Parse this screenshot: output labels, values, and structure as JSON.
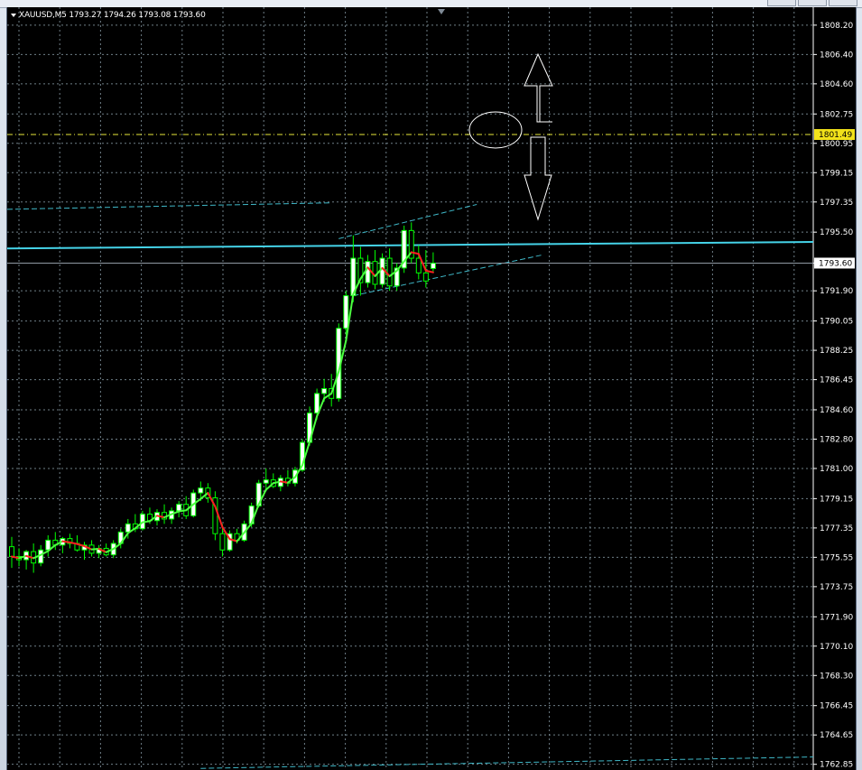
{
  "window": {
    "symbol_menu_icon": "triangle-down-icon"
  },
  "chart_data": {
    "type": "candlestick",
    "symbol": "XAUUSD,M5",
    "header_text": "XAUUSD,M5  1793.27 1794.26 1793.08 1793.60",
    "ohlc_header": {
      "open": 1793.27,
      "high": 1794.26,
      "low": 1793.08,
      "close": 1793.6
    },
    "ylim": [
      1762.5,
      1809.3
    ],
    "yticks": [
      "1808.20",
      "1806.40",
      "1804.60",
      "1802.75",
      "1800.95",
      "1799.15",
      "1797.35",
      "1795.50",
      "1793.60",
      "1791.90",
      "1790.05",
      "1788.25",
      "1786.45",
      "1784.60",
      "1782.80",
      "1781.00",
      "1779.15",
      "1777.35",
      "1775.55",
      "1773.75",
      "1771.90",
      "1770.10",
      "1768.30",
      "1766.45",
      "1764.65",
      "1762.85"
    ],
    "grid": true,
    "bid_price": {
      "value": 1793.6,
      "label": "1793.60"
    },
    "alert_line": {
      "value": 1801.49,
      "label": "1801.49"
    },
    "candles": [
      [
        1776.2,
        1776.8,
        1774.9,
        1775.6
      ],
      [
        1775.6,
        1776.1,
        1775.0,
        1775.4
      ],
      [
        1775.4,
        1776.0,
        1774.8,
        1775.9
      ],
      [
        1775.9,
        1776.4,
        1774.6,
        1775.2
      ],
      [
        1775.2,
        1776.3,
        1775.0,
        1776.0
      ],
      [
        1776.0,
        1776.9,
        1775.6,
        1776.6
      ],
      [
        1776.6,
        1777.1,
        1776.0,
        1776.3
      ],
      [
        1776.3,
        1776.8,
        1775.8,
        1776.7
      ],
      [
        1776.7,
        1777.0,
        1776.1,
        1776.4
      ],
      [
        1776.4,
        1776.9,
        1775.9,
        1776.0
      ],
      [
        1776.0,
        1776.5,
        1775.4,
        1776.3
      ],
      [
        1776.3,
        1776.6,
        1775.6,
        1775.8
      ],
      [
        1775.8,
        1776.3,
        1775.5,
        1776.1
      ],
      [
        1776.1,
        1776.4,
        1775.6,
        1775.7
      ],
      [
        1775.7,
        1776.6,
        1775.5,
        1776.4
      ],
      [
        1776.4,
        1777.3,
        1776.1,
        1777.1
      ],
      [
        1777.1,
        1777.9,
        1776.7,
        1777.6
      ],
      [
        1777.6,
        1778.2,
        1777.1,
        1777.3
      ],
      [
        1777.3,
        1778.4,
        1777.2,
        1778.2
      ],
      [
        1778.2,
        1778.6,
        1777.6,
        1777.8
      ],
      [
        1777.8,
        1778.5,
        1777.5,
        1778.3
      ],
      [
        1778.3,
        1778.8,
        1777.6,
        1777.9
      ],
      [
        1777.9,
        1778.6,
        1777.6,
        1778.4
      ],
      [
        1778.4,
        1779.0,
        1778.0,
        1778.8
      ],
      [
        1778.8,
        1779.3,
        1777.9,
        1778.1
      ],
      [
        1778.1,
        1779.7,
        1778.0,
        1779.5
      ],
      [
        1779.5,
        1780.2,
        1779.0,
        1779.8
      ],
      [
        1779.8,
        1780.1,
        1778.9,
        1779.2
      ],
      [
        1779.2,
        1779.6,
        1776.6,
        1777.0
      ],
      [
        1777.0,
        1777.6,
        1775.6,
        1776.0
      ],
      [
        1776.0,
        1777.2,
        1775.9,
        1777.0
      ],
      [
        1777.0,
        1777.3,
        1776.4,
        1776.6
      ],
      [
        1776.6,
        1777.8,
        1776.5,
        1777.6
      ],
      [
        1777.6,
        1778.9,
        1777.4,
        1778.7
      ],
      [
        1778.7,
        1780.3,
        1778.6,
        1780.1
      ],
      [
        1780.1,
        1781.0,
        1779.6,
        1780.3
      ],
      [
        1780.3,
        1780.7,
        1779.8,
        1779.9
      ],
      [
        1779.9,
        1780.6,
        1779.6,
        1780.4
      ],
      [
        1780.4,
        1780.9,
        1779.9,
        1780.1
      ],
      [
        1780.1,
        1781.1,
        1779.9,
        1780.9
      ],
      [
        1780.9,
        1782.8,
        1780.8,
        1782.6
      ],
      [
        1782.6,
        1784.8,
        1782.4,
        1784.4
      ],
      [
        1784.4,
        1785.9,
        1784.0,
        1785.6
      ],
      [
        1785.6,
        1786.5,
        1785.1,
        1785.9
      ],
      [
        1785.9,
        1786.8,
        1784.8,
        1785.3
      ],
      [
        1785.3,
        1789.9,
        1785.1,
        1789.6
      ],
      [
        1789.6,
        1791.9,
        1789.2,
        1791.6
      ],
      [
        1791.6,
        1795.3,
        1791.2,
        1793.9
      ],
      [
        1793.9,
        1794.6,
        1791.6,
        1792.4
      ],
      [
        1792.4,
        1794.1,
        1792.1,
        1793.7
      ],
      [
        1793.7,
        1794.4,
        1792.0,
        1792.3
      ],
      [
        1792.3,
        1794.2,
        1792.1,
        1793.9
      ],
      [
        1793.9,
        1794.5,
        1791.9,
        1792.2
      ],
      [
        1792.2,
        1793.6,
        1791.9,
        1793.3
      ],
      [
        1793.3,
        1795.9,
        1793.0,
        1795.6
      ],
      [
        1795.6,
        1796.1,
        1793.6,
        1793.9
      ],
      [
        1793.9,
        1794.7,
        1792.6,
        1793.0
      ],
      [
        1793.0,
        1794.4,
        1792.1,
        1792.5
      ],
      [
        1793.27,
        1794.26,
        1793.08,
        1793.6
      ]
    ],
    "ma_bars_offset": 0
  },
  "colors": {
    "grid": "#6f7f88",
    "axis_text": "#ffffff",
    "bull_candle": "#ffffff",
    "bear_candle": "#000000",
    "wick": "#00ff00",
    "ma_up": "#4cff40",
    "ma_down": "#ff2020",
    "level_line": "#45d3e8",
    "channel": "#3fb8c8",
    "alert_line": "#e8e83a",
    "alert_bg": "#f2e21a",
    "bid_line": "#8f99a3",
    "arrow_outline": "#ffffff"
  }
}
